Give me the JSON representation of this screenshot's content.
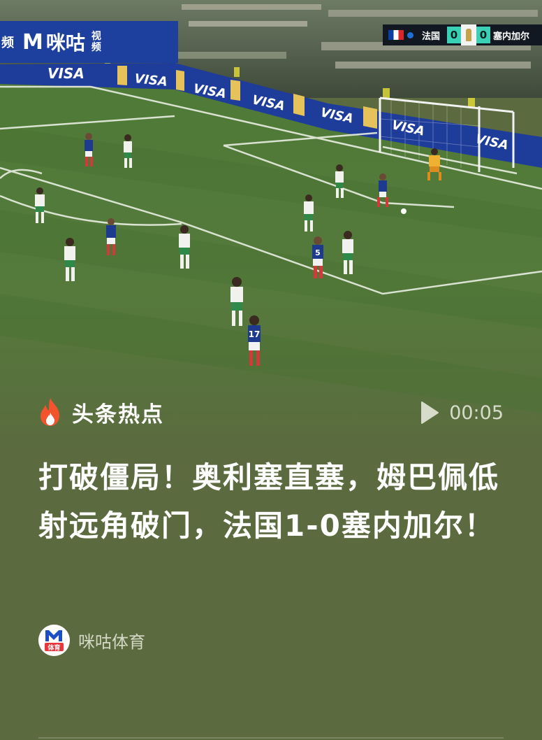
{
  "video": {
    "broadcaster": {
      "cut_text": "频",
      "mark": "M",
      "name": "咪咕",
      "tag": "视频"
    },
    "scoreboard": {
      "home_team": "法国",
      "home_score": "0",
      "away_score": "0",
      "away_team": "塞内加尔"
    },
    "ad_board_text": "VISA",
    "player_numbers": [
      "5",
      "17"
    ]
  },
  "card": {
    "topic_icon": "fire-icon",
    "topic_label": "头条热点",
    "play_icon": "play-icon",
    "duration": "00:05",
    "headline": "打破僵局！奥利塞直塞，姆巴佩低射远角破门，法国1-0塞内加尔！",
    "source_logo_text": "体育",
    "source_name": "咪咕体育"
  },
  "colors": {
    "panel_bg": "#5b6a3f",
    "fire": "#f2542d",
    "scoreboard_accent": "#3ad0b6",
    "broadcaster_blue": "#1d3f9e"
  }
}
